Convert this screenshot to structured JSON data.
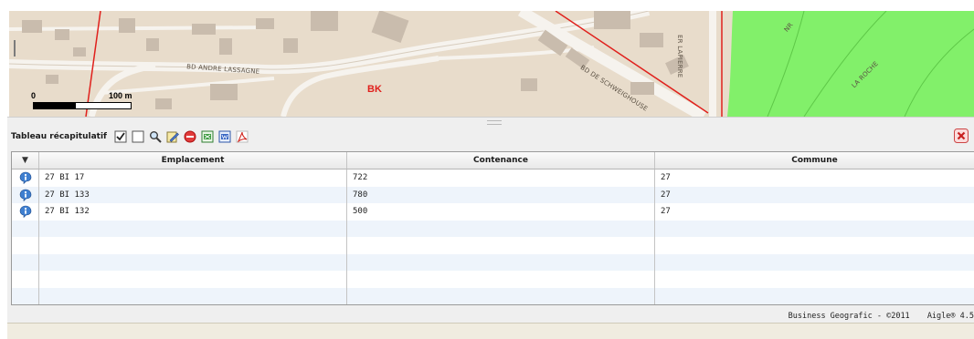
{
  "map": {
    "streets": {
      "bd_andre_lassagne": "BD ANDRE LASSAGNE",
      "bd_de_schweighouse": "BD DE SCHWEIGHOUSE",
      "lapierre": "ER LAPIERRE",
      "nr": "NR",
      "la_roche": "LA ROCHE"
    },
    "poi": "BK",
    "scale": {
      "zero": "0",
      "end": "100 m"
    },
    "colors": {
      "base": "#e8dccb",
      "green": "#82f06a",
      "road": "#f6f3ee",
      "building": "#c9bcad",
      "red_line": "#e0201c"
    }
  },
  "panel": {
    "title": "Tableau récapitulatif",
    "toolbar": [
      {
        "name": "select-all-checkbox",
        "icon": "checked-box-icon"
      },
      {
        "name": "deselect-checkbox",
        "icon": "empty-box-icon"
      },
      {
        "name": "zoom-search-button",
        "icon": "magnifier-icon"
      },
      {
        "name": "edit-button",
        "icon": "edit-icon"
      },
      {
        "name": "remove-button",
        "icon": "no-entry-icon"
      },
      {
        "name": "export-excel-button",
        "icon": "excel-icon"
      },
      {
        "name": "export-word-button",
        "icon": "word-icon"
      },
      {
        "name": "export-pdf-button",
        "icon": "pdf-icon"
      }
    ],
    "close_icon": "close-icon"
  },
  "grid": {
    "sort_icon": "▼",
    "columns": [
      "Emplacement",
      "Contenance",
      "Commune"
    ],
    "rows": [
      {
        "emplacement": "27 BI 17",
        "contenance": "722",
        "commune": "27"
      },
      {
        "emplacement": "27 BI 133",
        "contenance": "780",
        "commune": "27"
      },
      {
        "emplacement": "27 BI 132",
        "contenance": "500",
        "commune": "27"
      }
    ]
  },
  "footer": {
    "copyright": "Business Geografic - ©2011",
    "version": "Aigle® 4.5"
  }
}
